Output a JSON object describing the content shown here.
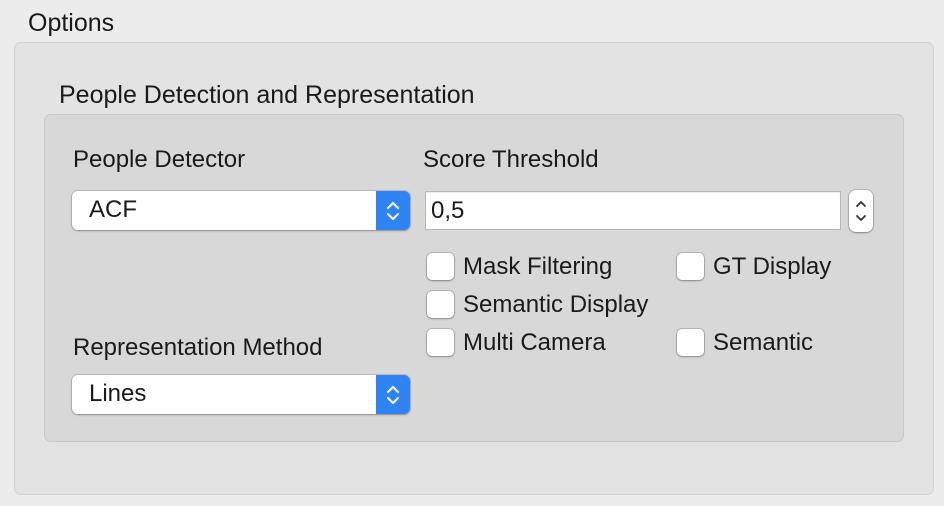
{
  "window": {
    "group_title": "Options"
  },
  "section": {
    "title": "People Detection and Representation"
  },
  "people_detector": {
    "label": "People Detector",
    "selected": "ACF"
  },
  "score_threshold": {
    "label": "Score Threshold",
    "value": "0,5"
  },
  "representation_method": {
    "label": "Representation Method",
    "selected": "Lines"
  },
  "checkboxes": {
    "mask_filtering": {
      "label": "Mask Filtering",
      "checked": false
    },
    "gt_display": {
      "label": "GT Display",
      "checked": false
    },
    "semantic_display": {
      "label": "Semantic Display",
      "checked": false
    },
    "multi_camera": {
      "label": "Multi Camera",
      "checked": false
    },
    "semantic": {
      "label": "Semantic",
      "checked": false
    }
  },
  "colors": {
    "accent": "#2f83f3",
    "window_bg": "#ececec",
    "group_bg": "#e3e3e3",
    "inner_bg": "#d8d8d8"
  },
  "icons": {
    "popup_arrows": "chevron-up-down-icon",
    "stepper": "stepper-arrows-icon"
  }
}
